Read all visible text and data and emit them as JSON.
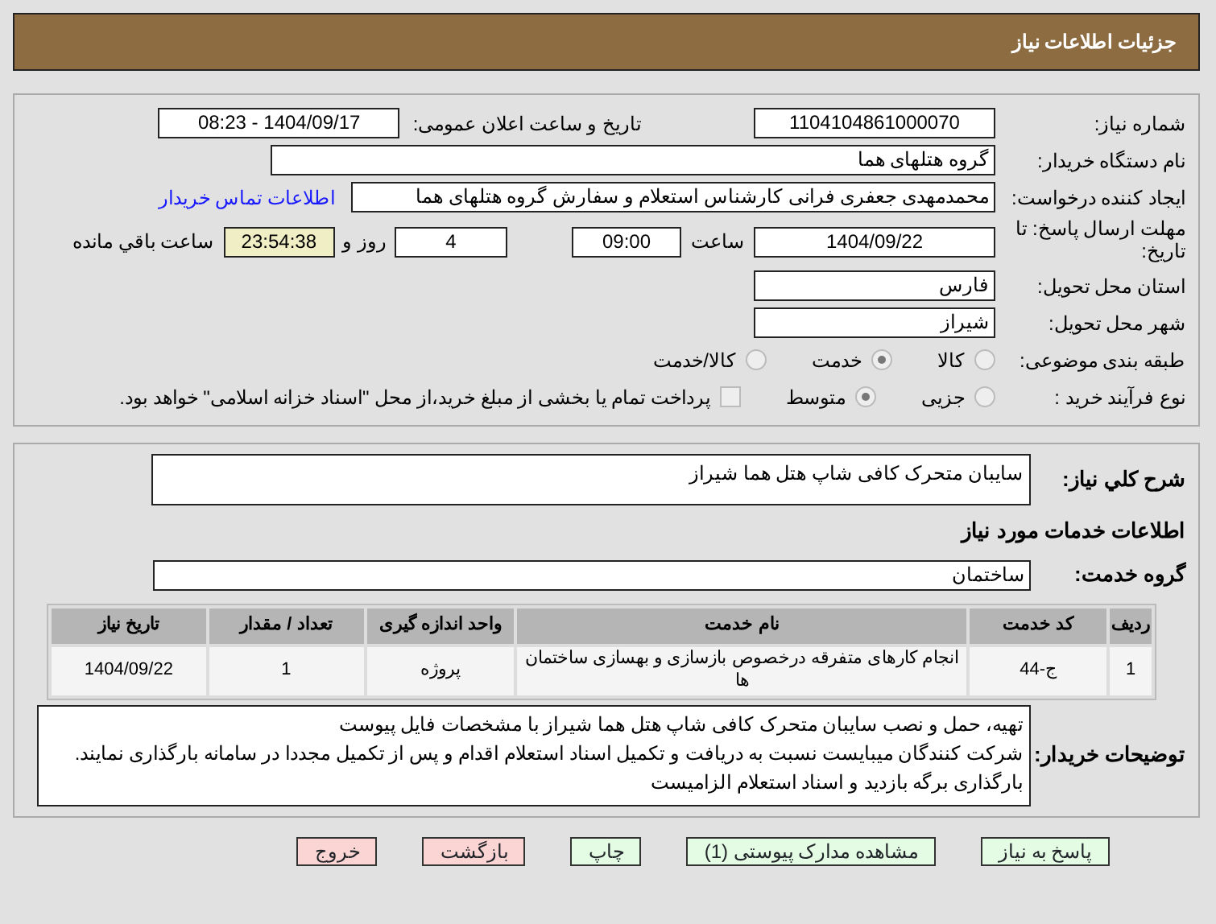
{
  "header": {
    "title": "جزئیات اطلاعات نیاز"
  },
  "need_number": {
    "label": "شماره نیاز:",
    "value": "1104104861000070"
  },
  "announce": {
    "label": "تاریخ و ساعت اعلان عمومی:",
    "value": "1404/09/17 - 08:23"
  },
  "buyer": {
    "label": "نام دستگاه خریدار:",
    "value": "گروه هتلهای هما"
  },
  "creator": {
    "label": "ایجاد کننده درخواست:",
    "value": "محمدمهدی جعفری فرانی کارشناس استعلام و سفارش گروه هتلهای هما",
    "link": "اطلاعات تماس خریدار"
  },
  "deadline": {
    "label": "مهلت ارسال پاسخ: تا تاریخ:",
    "date": "1404/09/22",
    "time_label": "ساعت",
    "time": "09:00",
    "days": "4",
    "days_label": "روز و",
    "remaining": "23:54:38",
    "remaining_label": "ساعت باقي مانده"
  },
  "province": {
    "label": "استان محل تحویل:",
    "value": "فارس"
  },
  "city": {
    "label": "شهر محل تحویل:",
    "value": "شیراز"
  },
  "category": {
    "label": "طبقه بندی موضوعی:",
    "options": [
      {
        "label": "کالا",
        "selected": false
      },
      {
        "label": "خدمت",
        "selected": true
      },
      {
        "label": "کالا/خدمت",
        "selected": false
      }
    ]
  },
  "process": {
    "label": "نوع فرآیند خرید :",
    "options": [
      {
        "label": "جزیی",
        "selected": false
      },
      {
        "label": "متوسط",
        "selected": true
      }
    ],
    "payment": {
      "label": "پرداخت تمام یا بخشی از مبلغ خرید،از محل \"اسناد خزانه اسلامی\" خواهد بود.",
      "checked": false
    }
  },
  "summary": {
    "label": "شرح کلي نياز:",
    "value": "سایبان متحرک کافی شاپ هتل هما شیراز"
  },
  "services_heading": "اطلاعات خدمات مورد نياز",
  "service_group": {
    "label": "گروه خدمت:",
    "value": "ساختمان"
  },
  "table": {
    "columns": [
      "ردیف",
      "کد خدمت",
      "نام خدمت",
      "واحد اندازه گیری",
      "تعداد / مقدار",
      "تاریخ نیاز"
    ],
    "rows": [
      [
        "1",
        "ج-44",
        "انجام کارهای متفرقه درخصوص بازسازی و بهسازی ساختمان ها",
        "پروژه",
        "1",
        "1404/09/22"
      ]
    ]
  },
  "description": {
    "label": "توضیحات خریدار:",
    "lines": [
      "تهیه، حمل و نصب سایبان متحرک کافی شاپ هتل هما شیراز با مشخصات فایل پیوست",
      "شرکت کنندگان میبایست نسبت به دریافت و تکمیل اسناد استعلام اقدام و پس از تکمیل مجددا در سامانه بارگذاری نمایند.",
      "بارگذاری برگه بازدید و اسناد استعلام الزامیست"
    ]
  },
  "buttons": [
    {
      "label": "پاسخ به نیاز",
      "kind": "action"
    },
    {
      "label": "مشاهده مدارک پیوستی (1)",
      "kind": "action"
    },
    {
      "label": "چاپ",
      "kind": "action"
    },
    {
      "label": "بازگشت",
      "kind": "exit"
    },
    {
      "label": "خروج",
      "kind": "exit"
    }
  ]
}
